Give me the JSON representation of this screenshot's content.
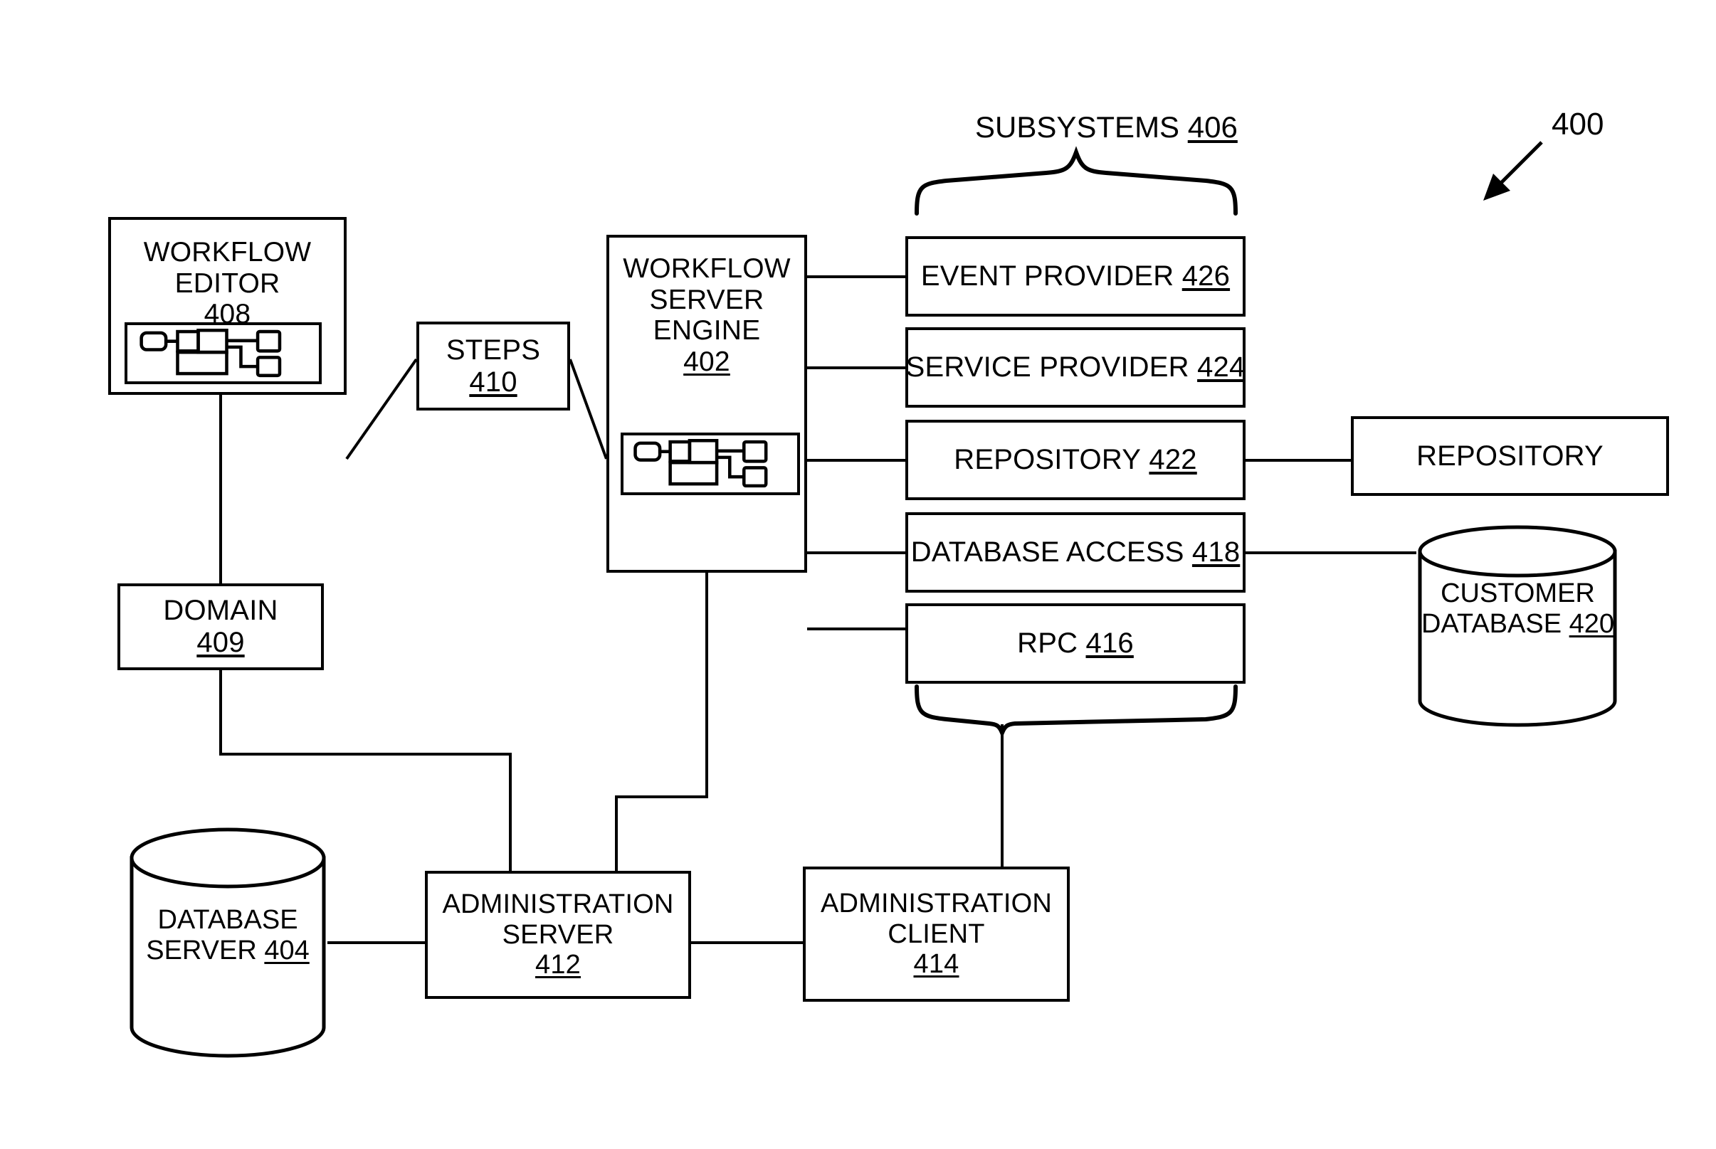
{
  "figure": {
    "reference_numeral": "400",
    "subsystems_group": {
      "label": "SUBSYSTEMS",
      "numeral": "406"
    }
  },
  "nodes": {
    "workflow_editor": {
      "line1": "WORKFLOW",
      "line2": "EDITOR",
      "numeral": "408",
      "icon": "workflow-mini-diagram"
    },
    "steps": {
      "line1": "STEPS",
      "numeral": "410"
    },
    "workflow_server_engine": {
      "line1": "WORKFLOW",
      "line2": "SERVER",
      "line3": "ENGINE",
      "numeral": "402",
      "icon": "workflow-mini-diagram"
    },
    "domain": {
      "line1": "DOMAIN",
      "numeral": "409"
    },
    "database_server": {
      "line1": "DATABASE",
      "line2": "SERVER",
      "numeral": "404",
      "shape": "cylinder"
    },
    "administration_server": {
      "line1": "ADMINISTRATION",
      "line2": "SERVER",
      "numeral": "412"
    },
    "administration_client": {
      "line1": "ADMINISTRATION",
      "line2": "CLIENT",
      "numeral": "414"
    },
    "repository_store": {
      "line1": "REPOSITORY",
      "numeral": ""
    },
    "customer_database": {
      "line1": "CUSTOMER",
      "line2": "DATABASE",
      "numeral": "420",
      "shape": "cylinder"
    }
  },
  "subsystems": [
    {
      "label": "EVENT PROVIDER",
      "numeral": "426"
    },
    {
      "label": "SERVICE PROVIDER",
      "numeral": "424"
    },
    {
      "label": "REPOSITORY",
      "numeral": "422"
    },
    {
      "label": "DATABASE ACCESS",
      "numeral": "418"
    },
    {
      "label": "RPC",
      "numeral": "416"
    }
  ],
  "colors": {
    "ink": "#000000",
    "paper": "#ffffff"
  }
}
